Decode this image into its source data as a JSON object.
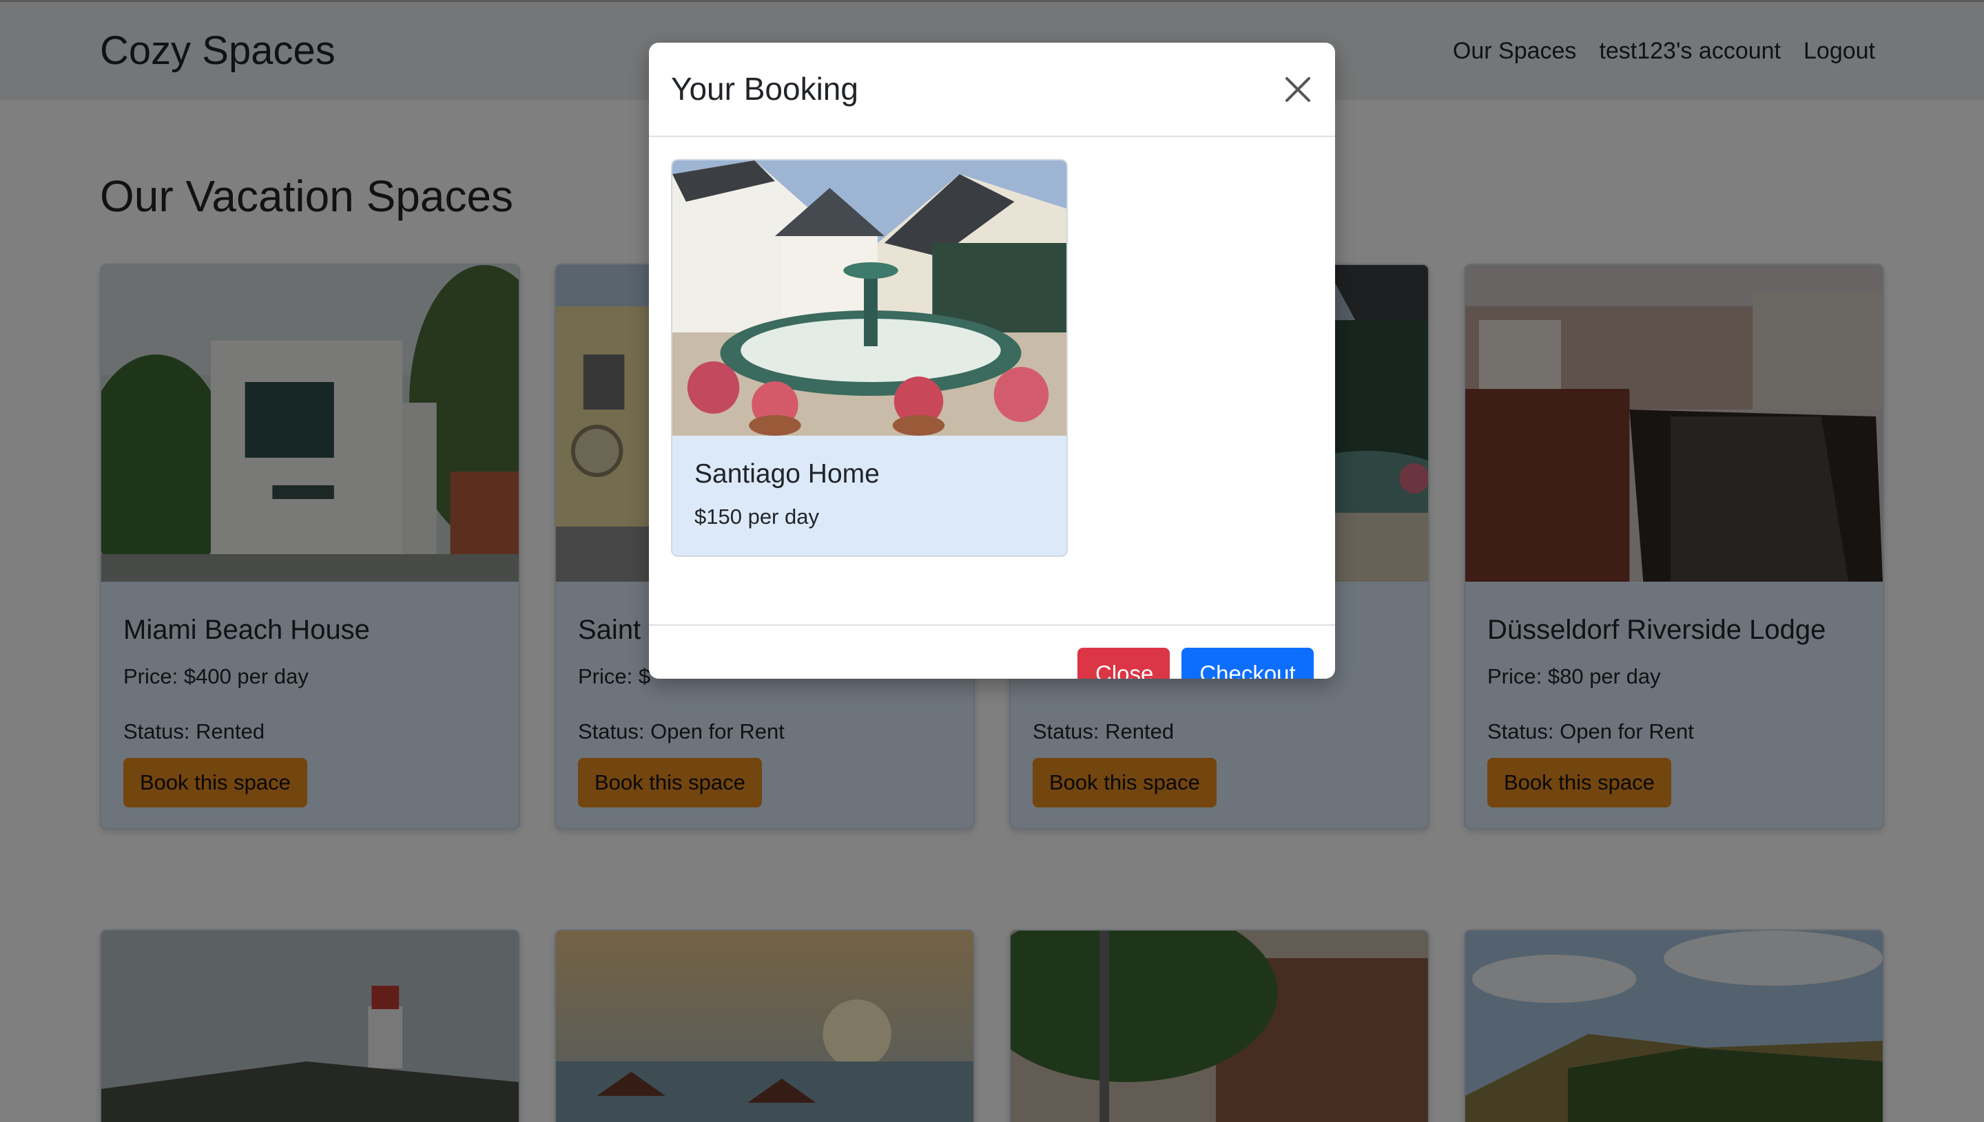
{
  "nav": {
    "brand": "Cozy Spaces",
    "links": [
      "Our Spaces",
      "test123's account",
      "Logout"
    ]
  },
  "main": {
    "heading": "Our Vacation Spaces",
    "cards": [
      {
        "title": "Miami Beach House",
        "price": "Price: $400 per day",
        "status": "Status: Rented",
        "button": "Book this space"
      },
      {
        "title": "Saint",
        "price": "Price: $",
        "status": "Status: Open for Rent",
        "button": "Book this space"
      },
      {
        "title": "",
        "price": "",
        "status": "Status: Rented",
        "button": "Book this space"
      },
      {
        "title": "Düsseldorf Riverside Lodge",
        "price": "Price: $80 per day",
        "status": "Status: Open for Rent",
        "button": "Book this space"
      }
    ]
  },
  "modal": {
    "title": "Your Booking",
    "item": {
      "title": "Santiago Home",
      "price": "$150 per day"
    },
    "close_label": "Close",
    "checkout_label": "Checkout"
  },
  "colors": {
    "book_button": "#e68a1f",
    "close_button": "#dc3545",
    "checkout_button": "#0d6efd",
    "card_background": "#dbe9f9"
  }
}
